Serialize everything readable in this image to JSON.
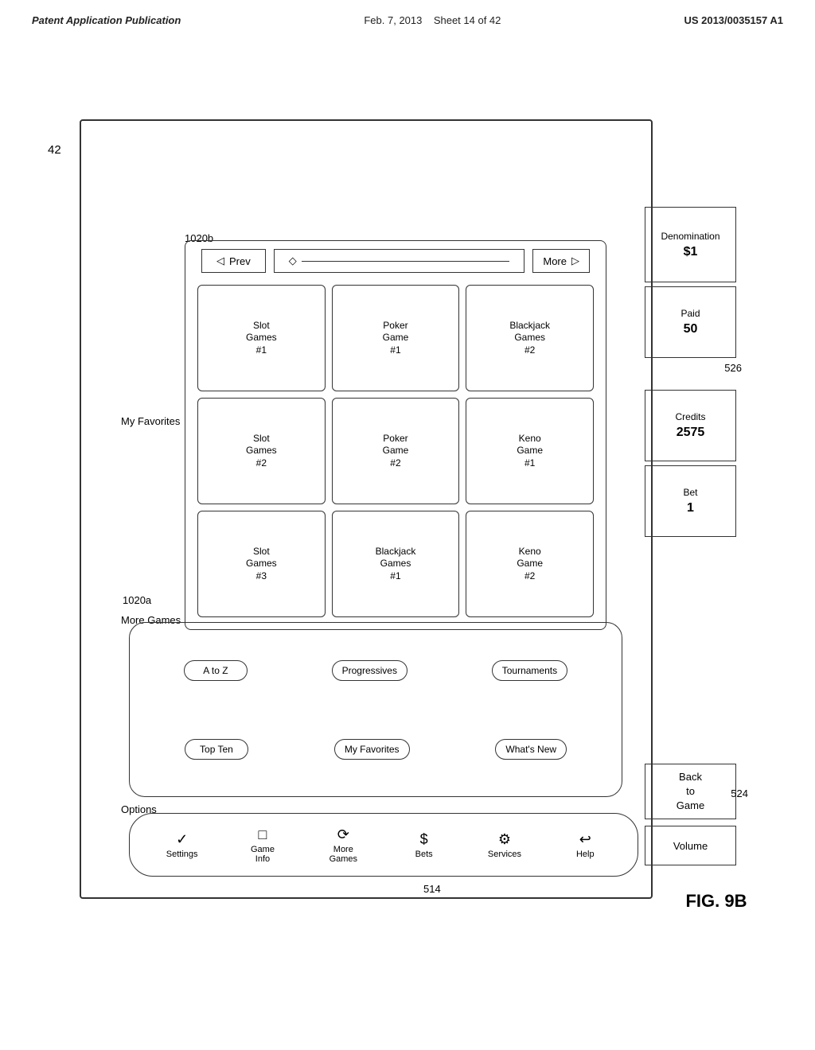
{
  "header": {
    "left": "Patent Application Publication",
    "center_date": "Feb. 7, 2013",
    "center_sheet": "Sheet 14 of 42",
    "right": "US 2013/0035157 A1"
  },
  "fig_label": "FIG. 9B",
  "ref_numbers": {
    "r42": "42",
    "r514": "514",
    "r524": "524",
    "r526": "526",
    "r1020a": "1020a",
    "r1020b": "1020b"
  },
  "labels": {
    "options": "Options",
    "more_games": "More Games",
    "my_favorites": "My Favorites"
  },
  "nav_items": [
    {
      "icon": "✓",
      "label": "Settings"
    },
    {
      "icon": "",
      "label": "Game\nInfo"
    },
    {
      "icon": "⟳",
      "label": "More\nGames"
    },
    {
      "icon": "$",
      "label": "Bets"
    },
    {
      "icon": "⚙",
      "label": "Services"
    },
    {
      "icon": "↩",
      "label": "Help"
    }
  ],
  "more_games_pills": [
    "A to Z",
    "Progressives",
    "Tournaments",
    "Top Ten",
    "My Favorites",
    "What's New"
  ],
  "nav_arrows": {
    "prev": "Prev",
    "more": "More"
  },
  "game_cards": [
    "Slot\nGames\n#1",
    "Poker\nGame\n#1",
    "Blackjack\nGames\n#2",
    "Slot\nGames\n#2",
    "Poker\nGame\n#2",
    "Keno\nGame\n#1",
    "Slot\nGames\n#3",
    "Blackjack\nGames\n#1",
    "Keno\nGame\n#2"
  ],
  "right_panel": [
    {
      "label": "Back\nto\nGame",
      "value": ""
    },
    {
      "label": "Volume",
      "value": ""
    },
    {
      "label": "Bet",
      "value": "1"
    },
    {
      "label": "Credits",
      "value": "2575"
    },
    {
      "label": "Paid",
      "value": "50"
    },
    {
      "label": "Denomination",
      "value": "$1"
    }
  ]
}
